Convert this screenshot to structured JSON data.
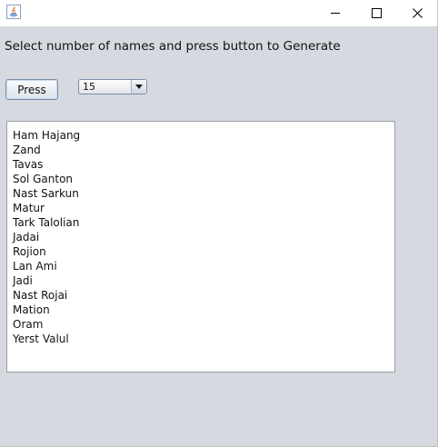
{
  "window": {
    "app_icon": "java-icon",
    "controls": {
      "minimize": "minimize-icon",
      "maximize": "maximize-icon",
      "close": "close-icon"
    }
  },
  "instruction": "Select number of names and press button to Generate",
  "press_button_label": "Press",
  "count_select": {
    "value": "15",
    "arrow_icon": "caret-down-icon"
  },
  "names": [
    "Ham Hajang",
    "Zand",
    "Tavas",
    "Sol Ganton",
    "Nast Sarkun",
    "Matur",
    "Tark Talolian",
    "Jadai",
    "Rojion",
    "Lan Ami",
    "Jadi",
    "Nast Rojai",
    "Mation",
    "Oram",
    "Yerst Valul"
  ],
  "colors": {
    "window_background": "#d6d9df",
    "titlebar_background": "#ffffff",
    "text_area_background": "#ffffff"
  }
}
